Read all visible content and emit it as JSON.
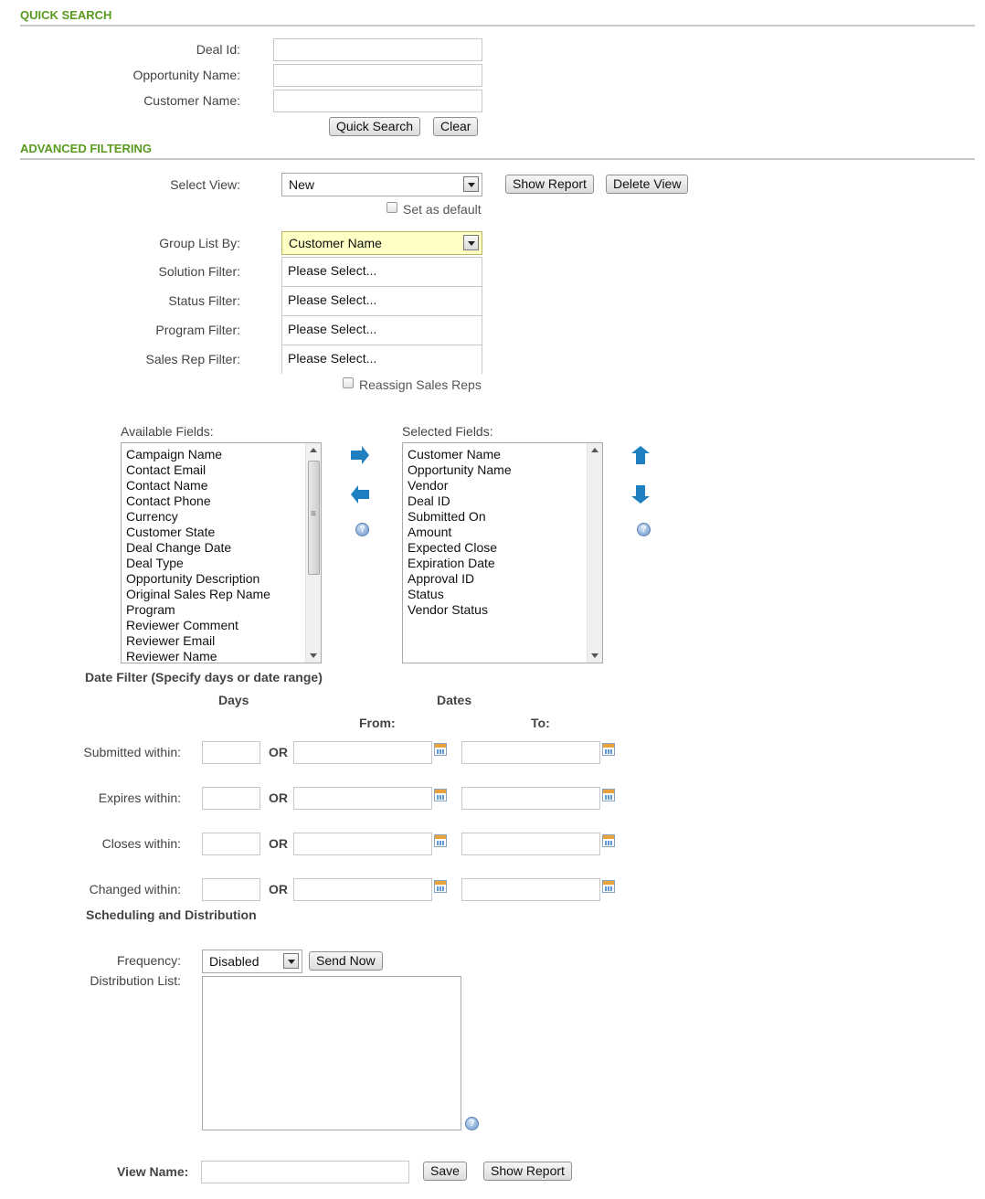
{
  "quick_search": {
    "title": "QUICK SEARCH",
    "deal_id_label": "Deal Id:",
    "opportunity_name_label": "Opportunity Name:",
    "customer_name_label": "Customer Name:",
    "deal_id_value": "",
    "opportunity_name_value": "",
    "customer_name_value": "",
    "quick_search_button": "Quick Search",
    "clear_button": "Clear"
  },
  "advanced": {
    "title": "ADVANCED FILTERING",
    "select_view_label": "Select View:",
    "select_view_value": "New",
    "show_report_button": "Show Report",
    "delete_view_button": "Delete View",
    "set_as_default_label": "Set as default",
    "group_list_by_label": "Group List By:",
    "group_list_by_value": "Customer Name",
    "solution_filter_label": "Solution Filter:",
    "status_filter_label": "Status Filter:",
    "program_filter_label": "Program Filter:",
    "sales_rep_filter_label": "Sales Rep Filter:",
    "please_select": "Please Select...",
    "reassign_label": "Reassign Sales Reps"
  },
  "fields": {
    "available_label": "Available Fields:",
    "selected_label": "Selected Fields:",
    "available": [
      "Campaign Name",
      "Contact Email",
      "Contact Name",
      "Contact Phone",
      "Currency",
      "Customer State",
      "Deal Change Date",
      "Deal Type",
      "Opportunity Description",
      "Original Sales Rep Name",
      "Program",
      "Reviewer Comment",
      "Reviewer Email",
      "Reviewer Name"
    ],
    "selected": [
      "Customer Name",
      "Opportunity Name",
      "Vendor",
      "Deal ID",
      "Submitted On",
      "Amount",
      "Expected Close",
      "Expiration Date",
      "Approval ID",
      "Status",
      "Vendor Status"
    ]
  },
  "date_filter": {
    "title": "Date Filter (Specify days or date range)",
    "days_header": "Days",
    "dates_header": "Dates",
    "from_header": "From:",
    "to_header": "To:",
    "or_text": "OR",
    "rows": [
      {
        "label": "Submitted within:"
      },
      {
        "label": "Expires within:"
      },
      {
        "label": "Closes within:"
      },
      {
        "label": "Changed within:"
      }
    ]
  },
  "scheduling": {
    "title": "Scheduling and Distribution",
    "frequency_label": "Frequency:",
    "frequency_value": "Disabled",
    "send_now_button": "Send Now",
    "distribution_list_label": "Distribution List:",
    "view_name_label": "View Name:",
    "save_button": "Save",
    "show_report_button": "Show Report"
  },
  "colors": {
    "section_title": "#5a9a1e",
    "highlight_select": "#ffffc6",
    "arrow_blue": "#1f7fc0"
  }
}
